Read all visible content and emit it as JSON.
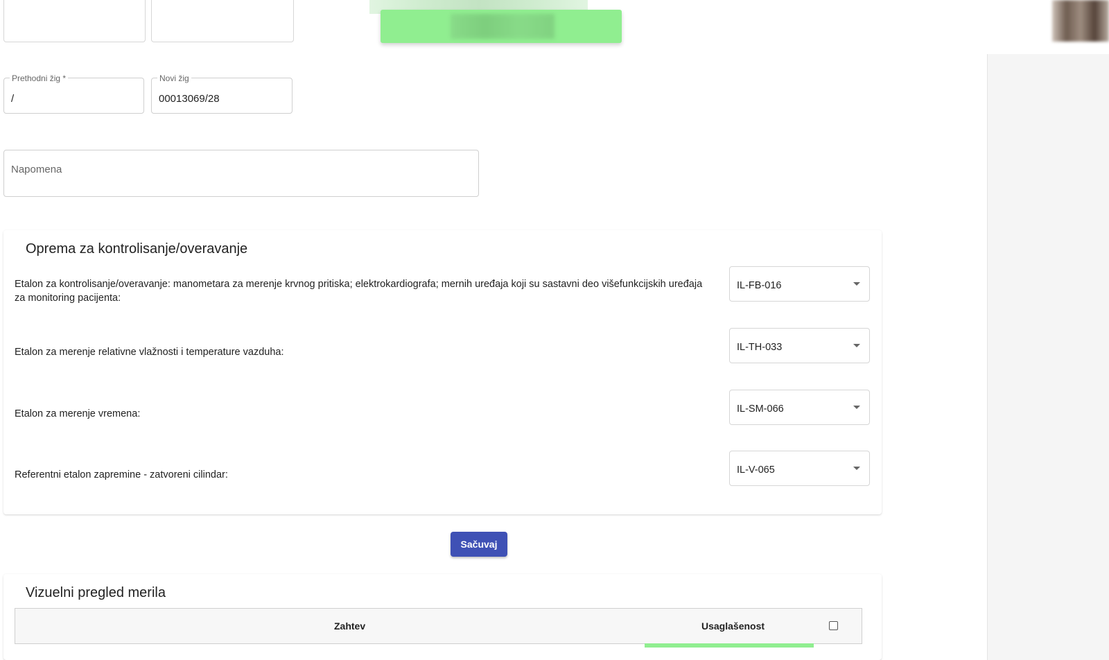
{
  "stamps": {
    "previous_label": "Prethodni žig *",
    "previous_value": "/",
    "new_label": "Novi žig",
    "new_value": "00013069/28"
  },
  "note": {
    "placeholder": "Napomena"
  },
  "equipment": {
    "title": "Oprema za kontrolisanje/overavanje",
    "rows": [
      {
        "label": "Etalon za kontrolisanje/overavanje: manometara za merenje krvnog pritiska; elektrokardiografa; mernih uređaja koji su sastavni deo višefunkcijskih uređaja za monitoring pacijenta:",
        "value": "IL-FB-016"
      },
      {
        "label": "Etalon za merenje relativne vlažnosti i temperature vazduha:",
        "value": "IL-TH-033"
      },
      {
        "label": "Etalon za merenje vremena:",
        "value": "IL-SM-066"
      },
      {
        "label": "Referentni etalon zapremine - zatvoreni cilindar:",
        "value": "IL-V-065"
      }
    ]
  },
  "save_button": "Sačuvaj",
  "visual_inspection": {
    "title": "Vizuelni pregled merila",
    "col_requirement": "Zahtev",
    "col_compliance": "Usaglašenost"
  },
  "colors": {
    "primary": "#3f51b5",
    "toast": "#90ee90"
  }
}
